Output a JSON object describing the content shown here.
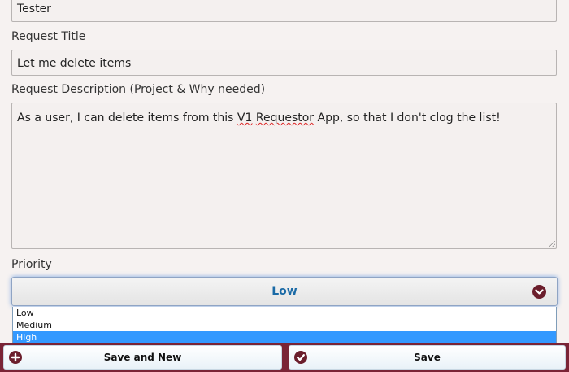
{
  "form": {
    "name_value": "Tester",
    "title_label": "Request Title",
    "title_value": "Let me delete items",
    "description_label": "Request Description (Project & Why needed)",
    "description_before": "As a user, I can delete items from this ",
    "description_misspelled_1": "V1",
    "description_space": " ",
    "description_misspelled_2": "Requestor",
    "description_after": " App, so that I don't clog the list!",
    "priority_label": "Priority",
    "priority_selected": "Low",
    "priority_options": [
      "Low",
      "Medium",
      "High"
    ],
    "priority_highlighted": "High"
  },
  "footer": {
    "save_new_label": "Save and New",
    "save_label": "Save"
  },
  "icons": {
    "dropdown": "chevron-down-circle-icon",
    "save_new": "plus-circle-icon",
    "save": "check-circle-icon"
  },
  "colors": {
    "accent": "#6b1e2c",
    "footer_bar": "#7a2436",
    "select_text": "#1a6aa6",
    "option_highlight": "#3399ff"
  }
}
